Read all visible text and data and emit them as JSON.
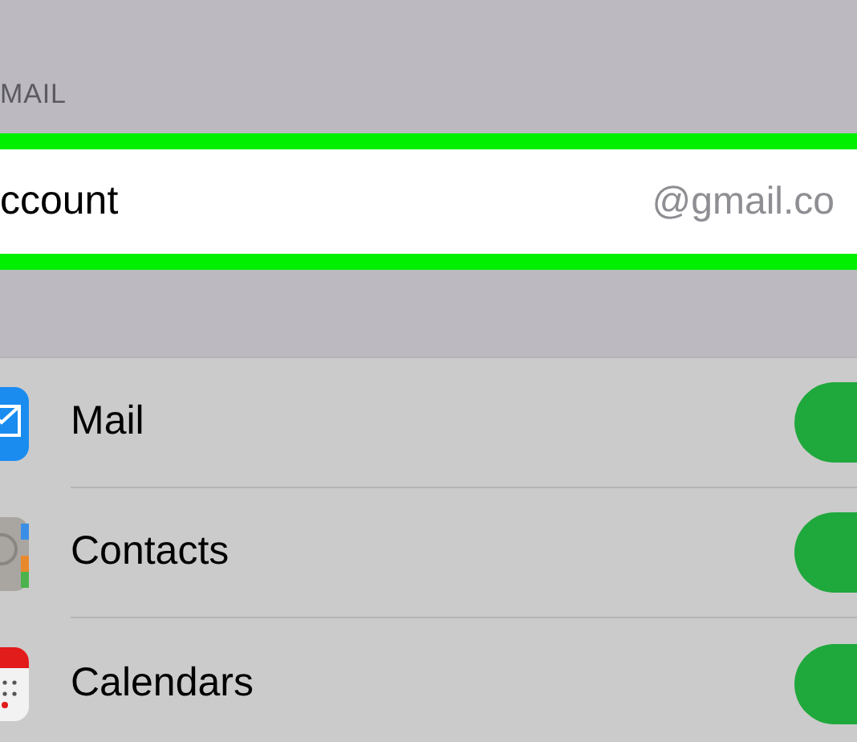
{
  "section_header": "MAIL",
  "account": {
    "label": "ccount",
    "value": "@gmail.co",
    "highlighted": true
  },
  "services": [
    {
      "kind": "mail",
      "label": "Mail",
      "on": true
    },
    {
      "kind": "contacts",
      "label": "Contacts",
      "on": true
    },
    {
      "kind": "calendars",
      "label": "Calendars",
      "on": true
    }
  ]
}
